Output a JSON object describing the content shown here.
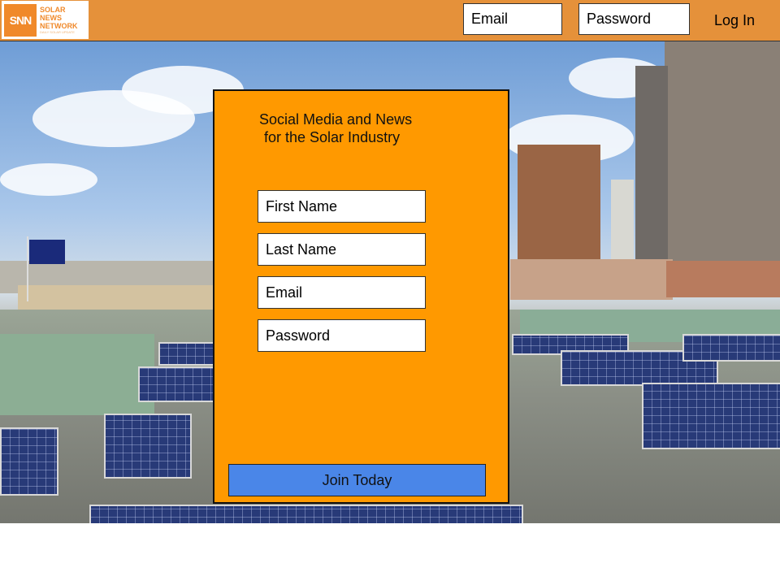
{
  "header": {
    "logo": {
      "mark": "SNN",
      "words": [
        "SOLAR",
        "NEWS",
        "NETWORK"
      ],
      "tagline": "DAILY SOLAR UPDATE"
    },
    "email_placeholder": "Email",
    "password_placeholder": "Password",
    "login_label": "Log In"
  },
  "signup": {
    "tagline_line1": "Social Media and News",
    "tagline_line2": "for the Solar Industry",
    "first_name_placeholder": "First Name",
    "last_name_placeholder": "Last Name",
    "email_placeholder": "Email",
    "password_placeholder": "Password",
    "join_label": "Join Today"
  },
  "colors": {
    "header_bg": "#e5913a",
    "signup_bg": "#ff9900",
    "button_blue": "#4a86e8"
  }
}
